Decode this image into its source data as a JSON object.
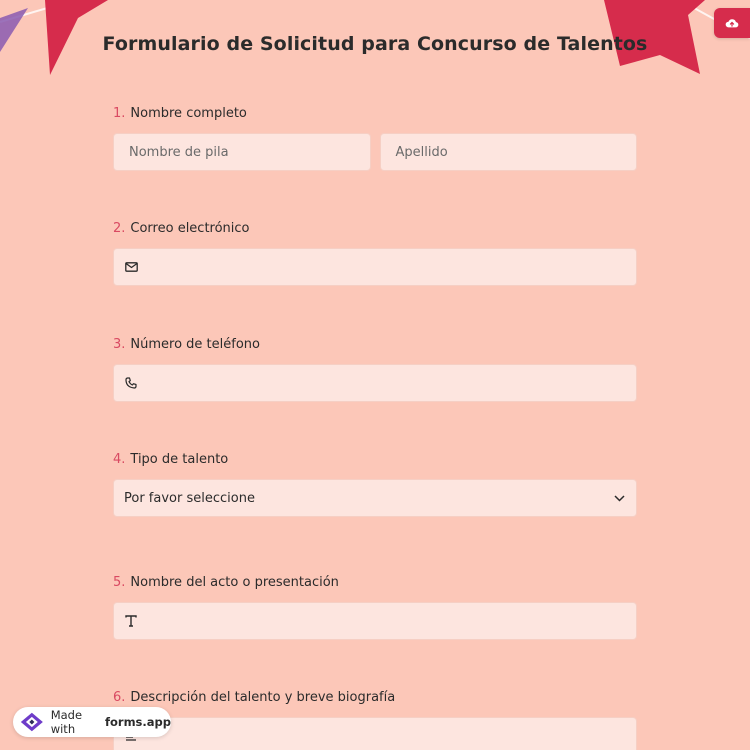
{
  "form": {
    "title": "Formulario de Solicitud para Concurso de Talentos",
    "questions": [
      {
        "num": "1.",
        "label": "Nombre completo",
        "first_placeholder": "Nombre de pila",
        "last_placeholder": "Apellido"
      },
      {
        "num": "2.",
        "label": "Correo electrónico",
        "icon": "envelope-icon"
      },
      {
        "num": "3.",
        "label": "Número de teléfono",
        "icon": "phone-icon"
      },
      {
        "num": "4.",
        "label": "Tipo de talento",
        "selected": "Por favor seleccione",
        "icon": "chevron-down-icon"
      },
      {
        "num": "5.",
        "label": "Nombre del acto o presentación",
        "icon": "text-T-icon"
      },
      {
        "num": "6.",
        "label": "Descripción del talento y breve biografía",
        "icon": "text-lines-icon"
      }
    ]
  },
  "badge": {
    "prefix": "Made with",
    "brand": "forms.app"
  },
  "colors": {
    "background": "#fcc7b8",
    "field": "#fde5df",
    "accent": "#d62c4c",
    "number": "#d94a62"
  },
  "icons": {
    "upload": "cloud-upload-icon",
    "logo": "forms-app-logo-icon"
  }
}
